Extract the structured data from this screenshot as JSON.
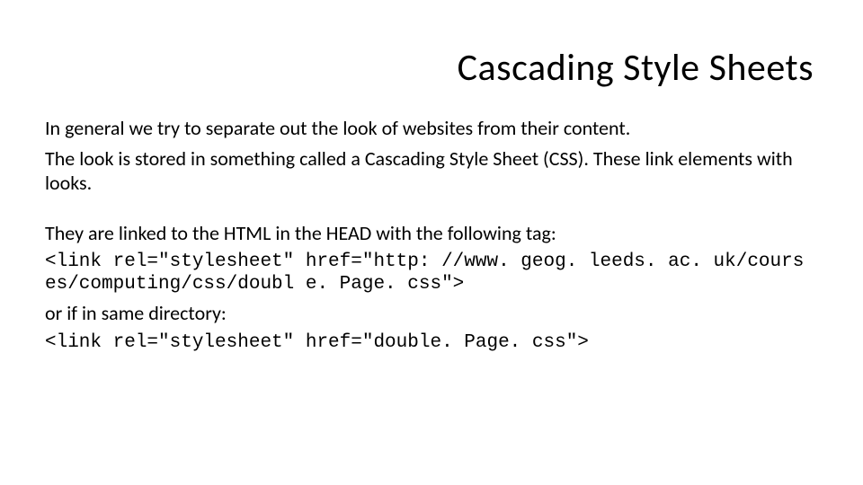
{
  "title": "Cascading Style Sheets",
  "p1": "In general we try to separate out the look of websites from their content.",
  "p2": "The look is stored in something called a Cascading Style Sheet (CSS). These link elements with looks.",
  "p3": "They are linked to the HTML in the HEAD with the following tag:",
  "code1": "<link rel=\"stylesheet\" href=\"http: //www. geog. leeds. ac. uk/courses/computing/css/doubl e. Page. css\">",
  "p4": "or if in same directory:",
  "code2": "<link rel=\"stylesheet\" href=\"double. Page. css\">"
}
